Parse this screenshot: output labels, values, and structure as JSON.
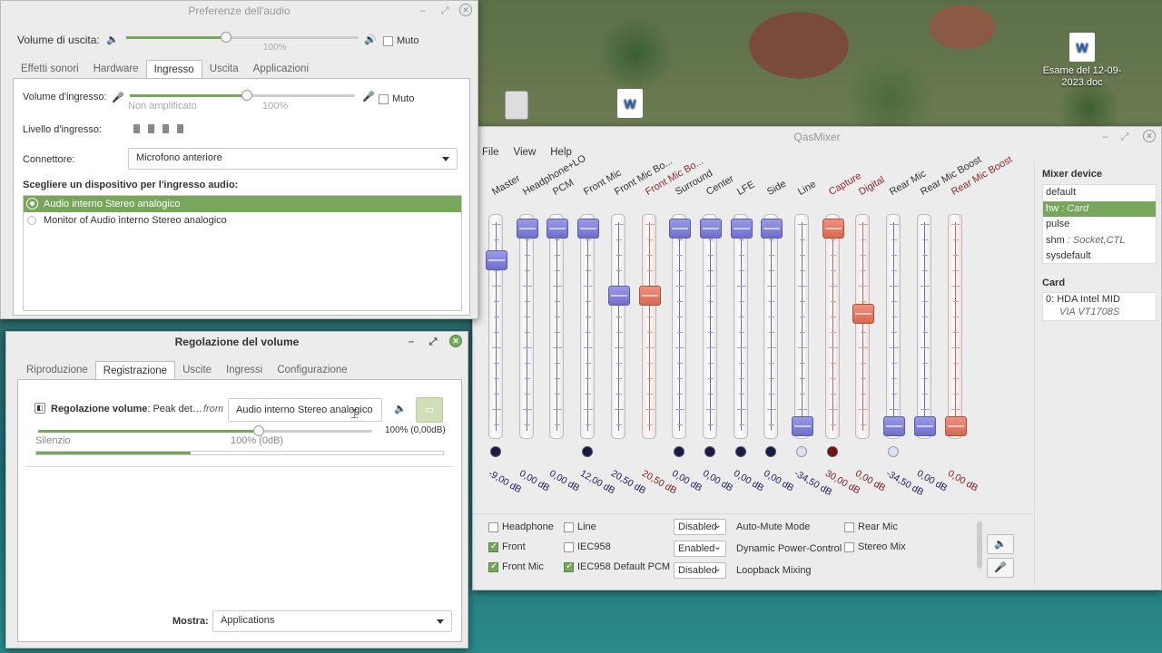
{
  "desktop": {
    "icon_file_label": "Esame del 12-09-2023.doc"
  },
  "audio_prefs": {
    "title": "Preferenze dell'audio",
    "output_volume_label": "Volume di uscita:",
    "output_volume_percent": "100%",
    "output_volume_value": 0.43,
    "mute_label": "Muto",
    "tabs": [
      "Effetti sonori",
      "Hardware",
      "Ingresso",
      "Uscita",
      "Applicazioni"
    ],
    "active_tab": "Ingresso",
    "input_volume_label": "Volume d'ingresso:",
    "input_volume_value": 0.52,
    "unamplified_label": "Non amplificato",
    "input_percent": "100%",
    "input_level_label": "Livello d'ingresso:",
    "connector_label": "Connettore:",
    "connector_value": "Microfono anteriore",
    "device_heading": "Scegliere un dispositivo per l'ingresso audio:",
    "devices": [
      "Audio interno Stereo analogico",
      "Monitor of Audio interno Stereo analogico"
    ]
  },
  "volume_control": {
    "title": "Regolazione del volume",
    "tabs": [
      "Riproduzione",
      "Registrazione",
      "Uscite",
      "Ingressi",
      "Configurazione"
    ],
    "active_tab": "Registrazione",
    "stream_name": "Regolazione volume",
    "stream_sub": ": Peak det…",
    "from_label": "from",
    "source_value": "Audio interno Stereo analogico",
    "vol_right": "100% (0,00dB)",
    "silence_label": "Silenzio",
    "mid_label": "100% (0dB)",
    "volume_value": 0.66,
    "level_value": 0.38,
    "show_label": "Mostra:",
    "show_value": "Applications"
  },
  "qasmixer": {
    "title": "QasMixer",
    "menu": [
      "File",
      "View",
      "Help"
    ],
    "channels": [
      {
        "name": "Master",
        "db": "-9,00 dB",
        "level": 0.84,
        "red": false,
        "led": "on"
      },
      {
        "name": "Headphone+LO",
        "db": "0,00 dB",
        "level": 1.0,
        "red": false,
        "led": "none"
      },
      {
        "name": "PCM",
        "db": "0,00 dB",
        "level": 1.0,
        "red": false,
        "led": "none"
      },
      {
        "name": "Front Mic",
        "db": "12,00 dB",
        "level": 1.0,
        "red": false,
        "led": "on"
      },
      {
        "name": "Front Mic Bo...",
        "db": "20,50 dB",
        "level": 0.66,
        "red": false,
        "led": "none"
      },
      {
        "name": "Front Mic Bo...",
        "db": "20,50 dB",
        "level": 0.66,
        "red": true,
        "led": "none"
      },
      {
        "name": "Surround",
        "db": "0,00 dB",
        "level": 1.0,
        "red": false,
        "led": "on"
      },
      {
        "name": "Center",
        "db": "0,00 dB",
        "level": 1.0,
        "red": false,
        "led": "on"
      },
      {
        "name": "LFE",
        "db": "0,00 dB",
        "level": 1.0,
        "red": false,
        "led": "on"
      },
      {
        "name": "Side",
        "db": "0,00 dB",
        "level": 1.0,
        "red": false,
        "led": "on"
      },
      {
        "name": "Line",
        "db": "-34,50 dB",
        "level": 0.0,
        "red": false,
        "led": "off"
      },
      {
        "name": "Capture",
        "db": "30,00 dB",
        "level": 1.0,
        "red": true,
        "led": "red"
      },
      {
        "name": "Digital",
        "db": "0,00 dB",
        "level": 0.57,
        "red": true,
        "led": "none"
      },
      {
        "name": "Rear Mic",
        "db": "-34,50 dB",
        "level": 0.0,
        "red": false,
        "led": "off"
      },
      {
        "name": "Rear Mic Boost",
        "db": "0,00 dB",
        "level": 0.0,
        "red": false,
        "led": "none"
      },
      {
        "name": "Rear Mic Boost",
        "db": "0,00 dB",
        "level": 0.0,
        "red": true,
        "led": "none"
      }
    ],
    "extra_db": "0,00 dB",
    "switches_col1": [
      {
        "label": "Headphone",
        "on": false
      },
      {
        "label": "Front",
        "on": true
      },
      {
        "label": "Front Mic",
        "on": true
      }
    ],
    "switches_col2": [
      {
        "label": "Line",
        "on": false
      },
      {
        "label": "IEC958",
        "on": false
      },
      {
        "label": "IEC958 Default PCM",
        "on": true
      }
    ],
    "enums": [
      {
        "value": "Disabled",
        "label": "Auto-Mute Mode"
      },
      {
        "value": "Enabled",
        "label": "Dynamic Power-Control"
      },
      {
        "value": "Disabled",
        "label": "Loopback Mixing"
      }
    ],
    "switches_col3": [
      {
        "label": "Rear Mic",
        "on": false
      },
      {
        "label": "Stereo Mix",
        "on": false
      }
    ],
    "mixer_device_heading": "Mixer device",
    "devices": [
      {
        "name": "default",
        "sub": ""
      },
      {
        "name": "hw",
        "sub": ": Card"
      },
      {
        "name": "pulse",
        "sub": ""
      },
      {
        "name": "shm",
        "sub": ": Socket,CTL"
      },
      {
        "name": "sysdefault",
        "sub": ""
      }
    ],
    "active_device": "hw",
    "card_heading": "Card",
    "card_name": "0:  HDA Intel MID",
    "card_sub": "VIA VT1708S"
  }
}
